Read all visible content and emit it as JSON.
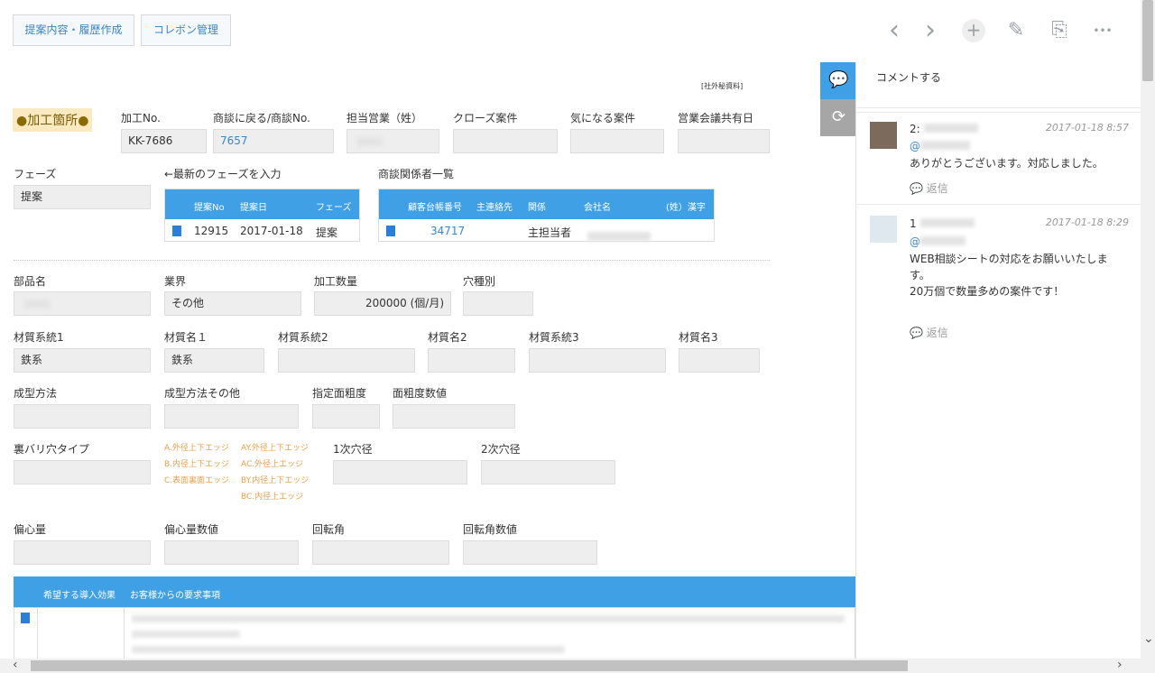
{
  "toolbar": {
    "btn1": "提案内容・履歴作成",
    "btn2": "コレボン管理",
    "prev_icon": "‹",
    "next_icon": "›",
    "add_icon": "+",
    "edit_icon": "✎",
    "copy_icon": "⎘",
    "more_icon": "•••"
  },
  "confidential": "[社外秘資料]",
  "marker": {
    "dot1": "●",
    "text": "加工箇所",
    "dot2": "●"
  },
  "row1": {
    "l1": "加工No.",
    "v1": "KK-7686",
    "l2": "商談に戻る/商談No.",
    "v2": "7657",
    "l3": "担当営業（姓）",
    "l4": "クローズ案件",
    "l5": "気になる案件",
    "l6": "営業会議共有日"
  },
  "phase": {
    "label": "フェーズ",
    "value": "提案",
    "latest_label": "←最新のフェーズを入力",
    "headers": [
      "提案No",
      "提案日",
      "フェーズ"
    ],
    "row": [
      "12915",
      "2017-01-18",
      "提案"
    ]
  },
  "related": {
    "label": "商談関係者一覧",
    "headers": [
      "顧客台帳番号",
      "主連絡先",
      "関係",
      "会社名",
      "(姓）漢字"
    ],
    "row": [
      "34717",
      "",
      "主担当者"
    ]
  },
  "row3": {
    "l1": "部品名",
    "l2": "業界",
    "v2": "その他",
    "l3": "加工数量",
    "v3": "200000 (個/月)",
    "l4": "穴種別"
  },
  "row4": {
    "l1": "材質系統1",
    "v1": "鉄系",
    "l2": "材質名１",
    "v2": "鉄系",
    "l3": "材質系統2",
    "l4": "材質名2",
    "l5": "材質系統3",
    "l6": "材質名3"
  },
  "row5": {
    "l1": "成型方法",
    "l2": "成型方法その他",
    "l3": "指定面粗度",
    "l4": "面粗度数値"
  },
  "row6": {
    "l1": "裏バリ穴タイプ",
    "opts_left": [
      "A.外径上下エッジ",
      "B.内径上下エッジ",
      "C.表面裏面エッジ"
    ],
    "opts_right": [
      "AY.外径上下エッジ",
      "AC.外径上エッジ",
      "BY.内径上下エッジ",
      "BC.内径上エッジ"
    ],
    "l2": "1次穴径",
    "l3": "2次穴径"
  },
  "row7": {
    "l1": "偏心量",
    "l2": "偏心量数値",
    "l3": "回転角",
    "l4": "回転角数値"
  },
  "section": {
    "h1": "希望する導入効果",
    "h2": "お客様からの要求事項"
  },
  "comments": {
    "header": "コメントする",
    "items": [
      {
        "num": "2:",
        "time": "2017-01-18 8:57",
        "lines": [
          "ありがとうございます。対応しました。"
        ],
        "reply": "返信"
      },
      {
        "num": "1",
        "time": "2017-01-18 8:29",
        "lines": [
          "WEB相談シートの対応をお願いいたしま",
          "す。",
          "20万個で数量多めの案件です！"
        ],
        "reply": "返信"
      }
    ]
  },
  "colors": {
    "accent": "#3fa0e6",
    "field": "#eeeeee",
    "orange": "#e8a04e"
  }
}
